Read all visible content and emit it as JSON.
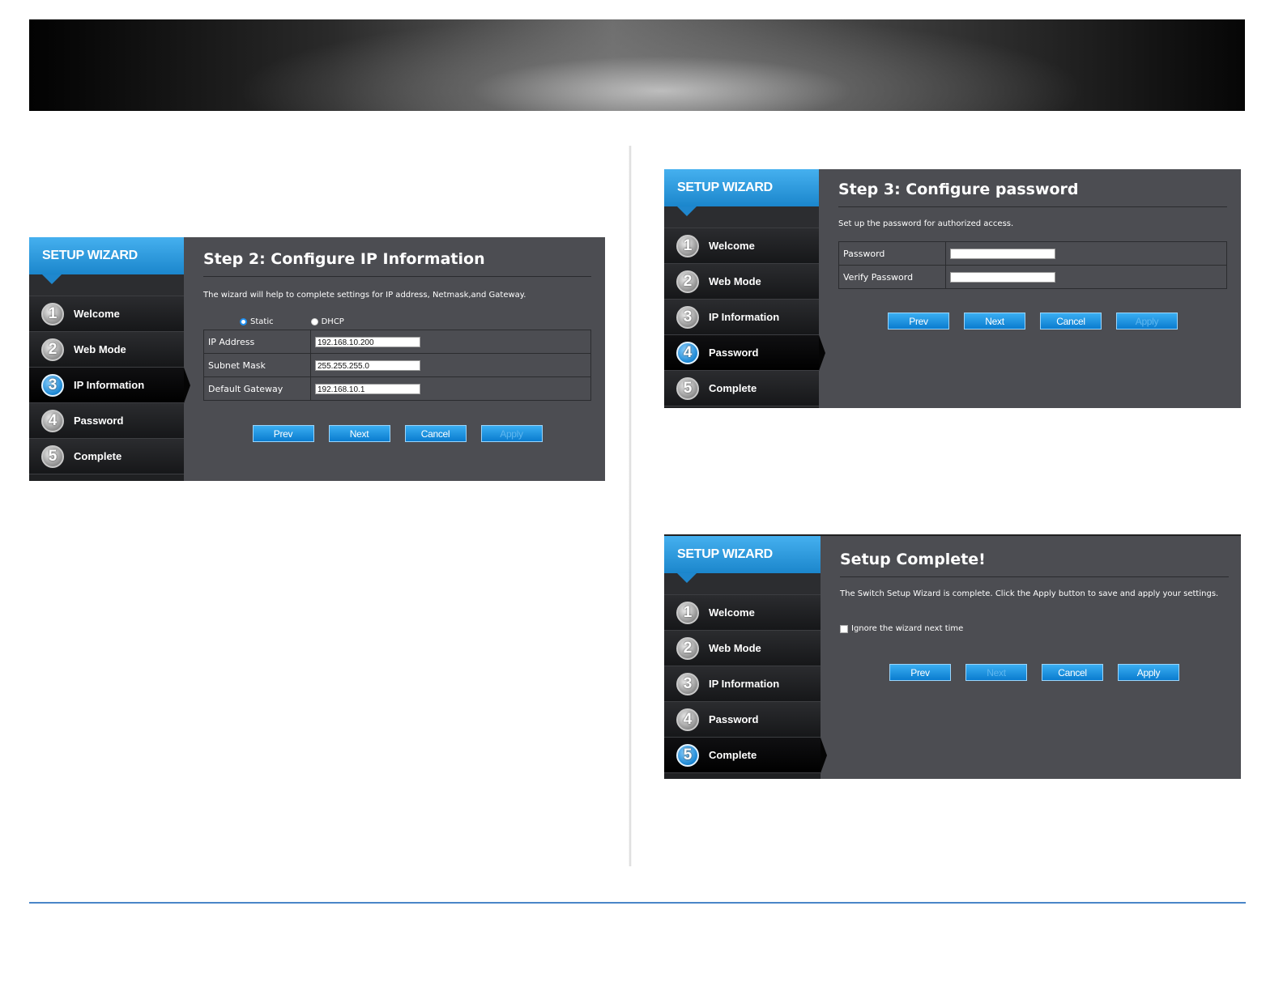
{
  "wizard_common": {
    "header": "SETUP WIZARD",
    "steps": [
      {
        "num": "1",
        "label": "Welcome"
      },
      {
        "num": "2",
        "label": "Web Mode"
      },
      {
        "num": "3",
        "label": "IP Information"
      },
      {
        "num": "4",
        "label": "Password"
      },
      {
        "num": "5",
        "label": "Complete"
      }
    ],
    "buttons": {
      "prev": "Prev",
      "next": "Next",
      "cancel": "Cancel",
      "apply": "Apply"
    }
  },
  "step2": {
    "active_step": 3,
    "title": "Step 2: Configure IP Information",
    "description": "The wizard will help to complete settings for IP address, Netmask,and Gateway.",
    "mode_options": [
      {
        "label": "Static",
        "selected": true
      },
      {
        "label": "DHCP",
        "selected": false
      }
    ],
    "fields": [
      {
        "label": "IP Address",
        "value": "192.168.10.200"
      },
      {
        "label": "Subnet Mask",
        "value": "255.255.255.0"
      },
      {
        "label": "Default Gateway",
        "value": "192.168.10.1"
      }
    ],
    "disabled_buttons": [
      "apply"
    ]
  },
  "step3": {
    "active_step": 4,
    "title": "Step 3: Configure password",
    "description": "Set up the password for authorized access.",
    "fields": [
      {
        "label": "Password",
        "value": ""
      },
      {
        "label": "Verify Password",
        "value": ""
      }
    ],
    "disabled_buttons": [
      "apply"
    ]
  },
  "complete": {
    "active_step": 5,
    "title": "Setup Complete!",
    "description": "The Switch Setup Wizard is complete. Click the Apply button to save and apply your settings.",
    "checkbox_label": "Ignore the wizard next time",
    "checkbox_checked": false,
    "disabled_buttons": [
      "next"
    ]
  },
  "colors": {
    "accent": "#1b86cc",
    "panel_bg": "#4c4d52",
    "footer_line": "#4a86c8"
  }
}
